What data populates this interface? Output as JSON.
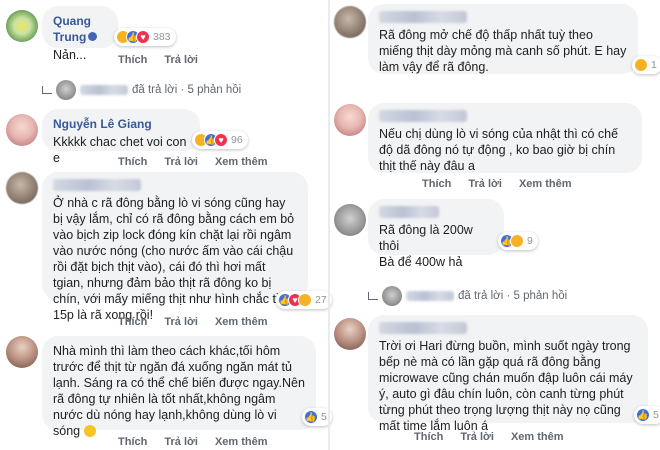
{
  "left": {
    "c1": {
      "author": "Quang Trung",
      "text": "Nản...",
      "reactions": "383"
    },
    "c1_actions": {
      "like": "Thích",
      "reply": "Trả lời"
    },
    "c1_replies": {
      "text": "đã trả lời · 5 phản hồi"
    },
    "c2": {
      "author": "Nguyễn Lê Giang",
      "text": "Kkkkk chac chet voi con e",
      "reactions": "96"
    },
    "c2_actions": {
      "like": "Thích",
      "reply": "Trả lời",
      "more": "Xem thêm"
    },
    "c3": {
      "text": "Ở nhà c rã đông bằng lò vi sóng cũng hay bị vậy lắm, chỉ có rã đông bằng cách em bỏ vào bịch zip lock đóng kín chặt lại rồi ngâm vào nước nóng (cho nước ấm vào cái chậu rồi đặt bịch thịt vào), cái đó thì hơi mất tgian, nhưng đảm bảo thịt rã đông ko bị chín, với mấy miếng thịt như hình chắc tầm 15p là rã xong rồi!",
      "reactions": "27"
    },
    "c3_actions": {
      "like": "Thích",
      "reply": "Trả lời",
      "more": "Xem thêm"
    },
    "c4": {
      "text": "Nhà mình thì làm theo cách khác,tối hôm trước để thịt từ ngăn đá xuống ngăn mát tủ lạnh. Sáng ra có thể chế biến được ngay.Nên rã đông tự nhiên là tốt nhất,không ngâm nước dù nóng hay lạnh,không dùng lò vi sóng",
      "reactions": "5"
    },
    "c4_actions": {
      "like": "Thích",
      "reply": "Trả lời",
      "more": "Xem thêm"
    }
  },
  "right": {
    "r1": {
      "text": "Rã đông mở chế độ thấp nhất tuỳ theo miếng thịt dày mỏng mà canh số phút. E hay làm vậy để rã đông.",
      "reactions": "1"
    },
    "r2": {
      "text": "Nếu chị dùng lò vi sóng của nhật thì có chế độ dã đông nó tự động , ko bao giờ bị chín thịt thế này đâu a"
    },
    "r2_actions": {
      "like": "Thích",
      "reply": "Trả lời",
      "more": "Xem thêm"
    },
    "r3": {
      "text": "Rã đông là 200w thôi\nBà để 400w hả",
      "reactions": "9"
    },
    "r3_replies": {
      "text": "đã trả lời · 5 phản hồi"
    },
    "r4": {
      "text": "Trời ơi Hari đừng buồn, mình suốt ngày trong bếp nè mà có lần gặp quá rã đông bằng microwave cũng chán muốn đập luôn cái máy ý, auto gì đâu chín luôn, còn canh từng phút từng phút theo trọng lượng thịt này nọ cũng mất time lắm luôn á",
      "reactions": "5"
    },
    "r4_actions": {
      "like": "Thích",
      "reply": "Trả lời",
      "more": "Xem thêm"
    }
  }
}
